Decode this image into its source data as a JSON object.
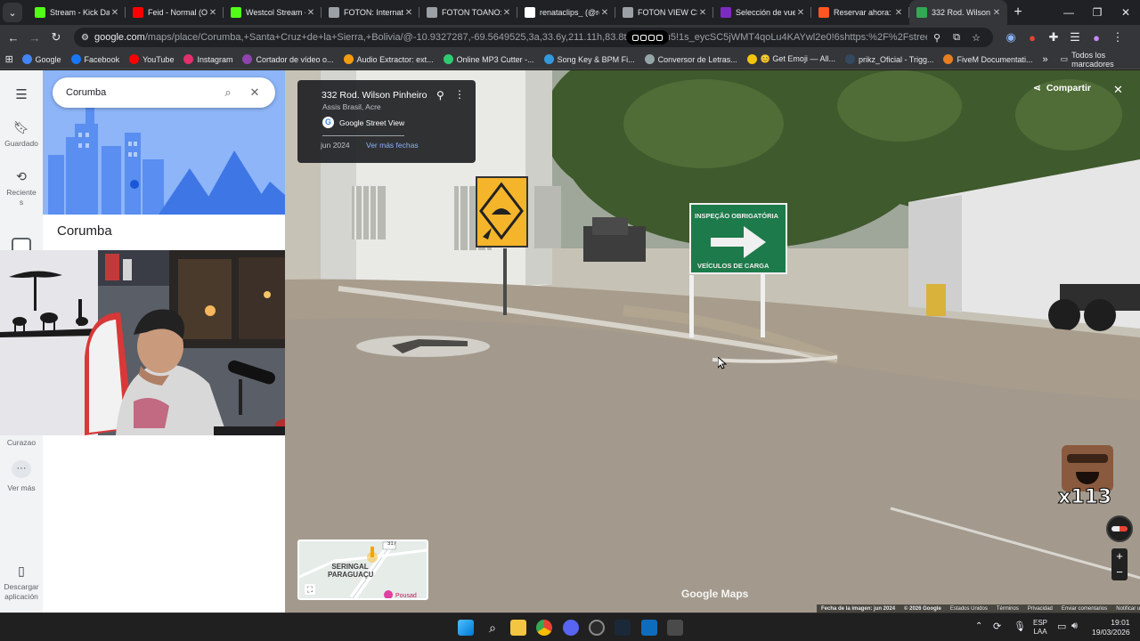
{
  "browser": {
    "tabs": [
      {
        "title": "Stream - Kick Da",
        "favicon": "kick-icon",
        "color": "#53fc18",
        "active": false
      },
      {
        "title": "Feid - Normal (Of",
        "favicon": "youtube-icon",
        "color": "#ff0000",
        "active": false
      },
      {
        "title": "Westcol Stream -",
        "favicon": "kick-icon",
        "color": "#53fc18",
        "active": false
      },
      {
        "title": "FOTON: Internatio",
        "favicon": "globe-icon",
        "color": "#9aa0a6",
        "active": false
      },
      {
        "title": "FOTON TOANO: C",
        "favicon": "globe-icon",
        "color": "#9aa0a6",
        "active": false
      },
      {
        "title": "renataclips_ (@re",
        "favicon": "tiktok-icon",
        "color": "#ffffff",
        "active": false
      },
      {
        "title": "FOTON VIEW CS2",
        "favicon": "globe-icon",
        "color": "#9aa0a6",
        "active": false
      },
      {
        "title": "Selección de vuel",
        "favicon": "flight-icon",
        "color": "#7b2cbf",
        "active": false
      },
      {
        "title": "Reservar ahora: Li",
        "favicon": "booking-icon",
        "color": "#ff5722",
        "active": false
      },
      {
        "title": "332 Rod. Wilson P",
        "favicon": "maps-icon",
        "color": "#34a853",
        "active": true
      }
    ],
    "url_domain": "google.com",
    "url_rest": "/maps/place/Corumba,+Santa+Cruz+de+la+Sierra,+Bolivia/@-10.9327287,-69.5649525,3a,33.6y,211.11h,83.8t/data=!3m5!1s_eycSC5jWMT4qoLu4KAYwl2e0!6shttps:%2F%2Fstreetviewpixels-pa.googleapi...",
    "bookmarks": [
      {
        "label": "Google",
        "color": "#4285f4"
      },
      {
        "label": "Facebook",
        "color": "#1877f2"
      },
      {
        "label": "YouTube",
        "color": "#ff0000"
      },
      {
        "label": "Instagram",
        "color": "#e1306c"
      },
      {
        "label": "Cortador de vídeo o...",
        "color": "#8e44ad"
      },
      {
        "label": "Audio Extractor: ext...",
        "color": "#f39c12"
      },
      {
        "label": "Online MP3 Cutter -...",
        "color": "#2ecc71"
      },
      {
        "label": "Song Key & BPM Fi...",
        "color": "#3498db"
      },
      {
        "label": "Conversor de Letras...",
        "color": "#95a5a6"
      },
      {
        "label": "😊 Get Emoji — All...",
        "color": "#f1c40f"
      },
      {
        "label": "prikz_Oficial - Trigg...",
        "color": "#34495e"
      },
      {
        "label": "FiveM Documentati...",
        "color": "#e67e22"
      }
    ],
    "bookmarks_folder": "Todos los marcadores"
  },
  "maps": {
    "search_value": "Corumba",
    "place_title": "Corumba",
    "rail": {
      "saved": "Guardado",
      "recents": "Recientes",
      "curazao": "Curazao",
      "more": "Ver más",
      "download": "Descargar aplicación"
    },
    "streetview": {
      "address": "332 Rod. Wilson Pinheiro",
      "locality": "Assis Brasil, Acre",
      "provider": "Google Street View",
      "date": "jun 2024",
      "more_dates": "Ver más fechas",
      "share": "Compartir",
      "watermark": "Google Maps",
      "sign_text_top": "INSPEÇÃO OBRIGATÓRIA",
      "sign_text_bottom": "VEÍCULOS DE CARGA",
      "minimap_label": "SERINGAL PARAGUAÇU",
      "minimap_road": "317",
      "minimap_poi": "Pousad",
      "footer": [
        "Fecha de la imagen: jun 2024",
        "© 2026 Google",
        "Estados Unidos",
        "Términos",
        "Privacidad",
        "Enviar comentarios",
        "Notificar un problema"
      ]
    },
    "overlay_counter": "x113"
  },
  "taskbar": {
    "language": "ESP",
    "layout": "LAA",
    "time": "19:01",
    "date": "19/03/2026"
  }
}
